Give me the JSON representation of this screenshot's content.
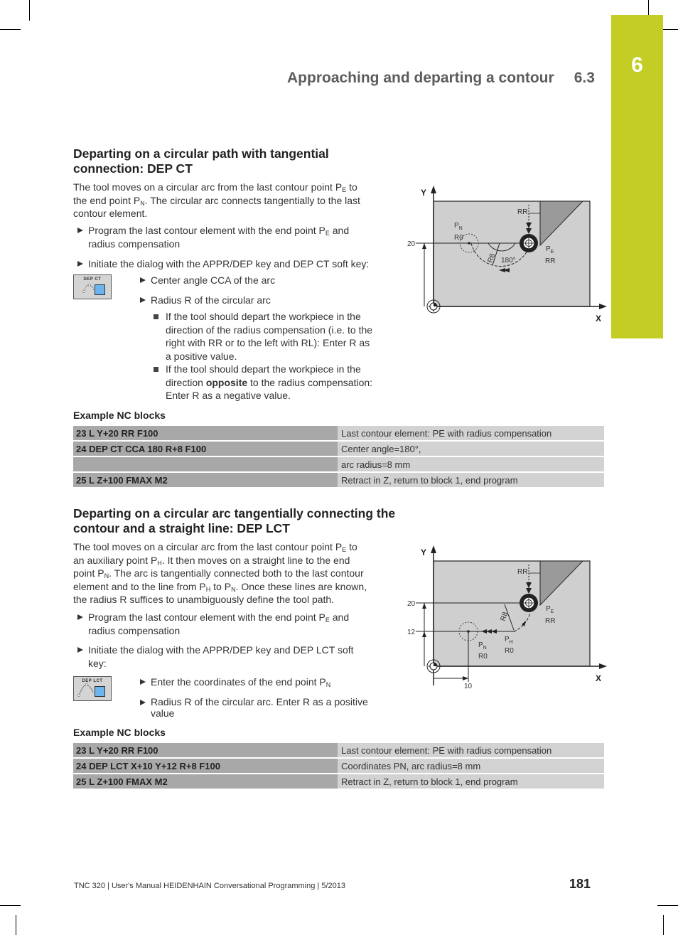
{
  "header": {
    "running_title": "Approaching and departing a contour",
    "section_number": "6.3",
    "chapter_tab": "6",
    "accent_color": "#c3cd23"
  },
  "section1": {
    "title_line1": "Departing on a circular path with tangential",
    "title_line2": "connection: DEP CT",
    "intro": {
      "line1_a": "The tool moves on a circular arc from the last contour point P",
      "line1_sub": "E",
      "line1_b": " to",
      "line2_a": "the end point P",
      "line2_sub": "N",
      "line2_b": ". The circular arc connects tangentially to the last",
      "line3": "contour element."
    },
    "step1": {
      "text_a": "Program the last contour element with the end point P",
      "sub": "E",
      "text_b": " and",
      "line2": "radius compensation"
    },
    "step2": "Initiate the dialog with the APPR/DEP key and DEP CT soft key:",
    "softkey": {
      "label": "DEP  CT",
      "icon": "dep-ct-softkey-icon"
    },
    "substeps": [
      "Center angle CCA of the arc",
      "Radius R of the circular arc"
    ],
    "notes": [
      {
        "lines": [
          "If the tool should depart the workpiece in the",
          "direction of the radius compensation (i.e. to the",
          "right with RR or to the left with RL): Enter R as",
          "a positive value."
        ]
      },
      {
        "line1": "If the tool should depart the workpiece in the",
        "line2_a": "direction ",
        "line2_bold": "opposite",
        "line2_b": " to the radius compensation:",
        "line3": "Enter R as a negative value."
      }
    ],
    "example_caption": "Example NC blocks",
    "nc_blocks": [
      {
        "code": "23 L Y+20 RR F100",
        "desc": "Last contour element: PE with radius compensation"
      },
      {
        "code": "24 DEP CT CCA 180 R+8 F100",
        "desc": "Center angle=180°,"
      },
      {
        "code": "",
        "desc": "arc radius=8 mm"
      },
      {
        "code": "25 L Z+100 FMAX M2",
        "desc": "Retract in Z, return to block 1, end program"
      }
    ],
    "figure": {
      "axis_x": "X",
      "axis_y": "Y",
      "y_tick": "20",
      "label_pn": "P",
      "label_pn_sub": "N",
      "label_pn_r": "R0",
      "label_pe": "P",
      "label_pe_sub": "E",
      "label_pe_r": "RR",
      "label_rr_top": "RR",
      "label_radius": "R8",
      "label_angle": "180°"
    }
  },
  "section2": {
    "title_line1": "Departing on a circular arc tangentially connecting the",
    "title_line2": "contour and a straight line: DEP LCT",
    "intro": {
      "line1_a": "The tool moves on a circular arc from the last contour point P",
      "line1_sub": "E",
      "line1_b": " to",
      "line2_a": "an auxiliary point P",
      "line2_sub": "H",
      "line2_b": ". It then moves on a straight line to the end",
      "line3_a": "point P",
      "line3_sub": "N",
      "line3_b": ". The arc is tangentially connected both to the last contour",
      "line4_a": "element and to the line from P",
      "line4_sub1": "H",
      "line4_b": " to P",
      "line4_sub2": "N",
      "line4_c": ". Once these lines are known,",
      "line5": "the radius R suffices to unambiguously define the tool path."
    },
    "step1": {
      "text_a": "Program the last contour element with the end point P",
      "sub": "E",
      "text_b": " and",
      "line2": "radius compensation"
    },
    "step2": {
      "line1": "Initiate the dialog with the APPR/DEP key and DEP LCT soft",
      "line2": "key:"
    },
    "softkey": {
      "label": "DEP  LCT",
      "icon": "dep-lct-softkey-icon"
    },
    "substeps": [
      {
        "text": "Enter the coordinates of the end point P",
        "sub": "N"
      },
      {
        "line1": "Radius R of the circular arc. Enter R as a positive",
        "line2": "value"
      }
    ],
    "example_caption": "Example NC blocks",
    "nc_blocks": [
      {
        "code": "23 L Y+20 RR F100",
        "desc": "Last contour element: PE with radius compensation"
      },
      {
        "code": "24 DEP LCT X+10 Y+12 R+8 F100",
        "desc": "Coordinates PN, arc radius=8 mm"
      },
      {
        "code": "25 L Z+100 FMAX M2",
        "desc": "Retract in Z, return to block 1, end program"
      }
    ],
    "figure": {
      "axis_x": "X",
      "axis_y": "Y",
      "y_tick_20": "20",
      "y_tick_12": "12",
      "x_tick_10": "10",
      "label_pn": "P",
      "label_pn_sub": "N",
      "label_pn_r": "R0",
      "label_ph": "P",
      "label_ph_sub": "H",
      "label_ph_r": "R0",
      "label_pe": "P",
      "label_pe_sub": "E",
      "label_pe_r": "RR",
      "label_rr_top": "RR",
      "label_radius": "R8"
    }
  },
  "footer": {
    "text": "TNC 320 | User's Manual HEIDENHAIN Conversational Programming | 5/2013",
    "page_number": "181"
  }
}
